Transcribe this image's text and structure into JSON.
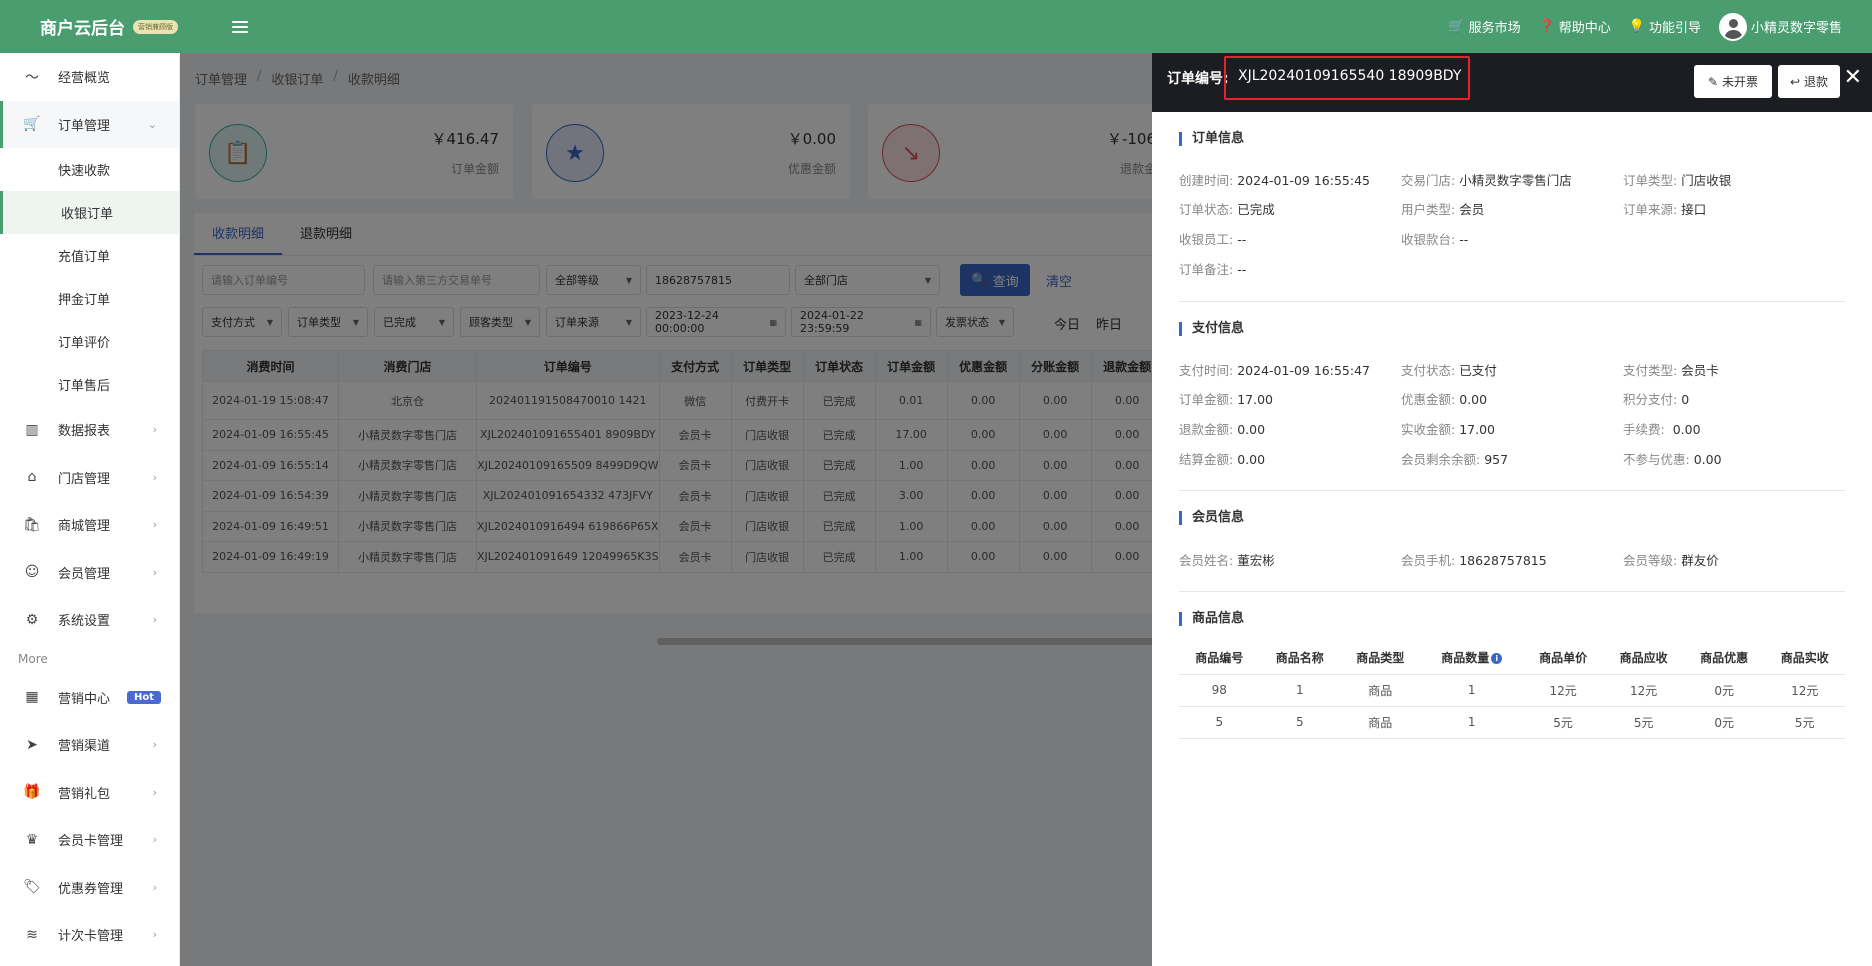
{
  "topbar": {
    "brand": "商户云后台",
    "brand_tag": "营销兼顾版",
    "links": [
      "服务市场",
      "帮助中心",
      "功能引导"
    ],
    "user": "小精灵数字零售"
  },
  "sidebar": {
    "items_top": [
      {
        "label": "经营概览",
        "icon": "chart-line-icon"
      },
      {
        "label": "订单管理",
        "icon": "cart-icon",
        "open": true
      }
    ],
    "sub_items": [
      "快速收款",
      "收银订单",
      "充值订单",
      "押金订单",
      "订单评价",
      "订单售后"
    ],
    "active_sub": "收银订单",
    "items_mid": [
      {
        "label": "数据报表",
        "icon": "bar-chart-icon"
      },
      {
        "label": "门店管理",
        "icon": "home-icon"
      },
      {
        "label": "商城管理",
        "icon": "shop-icon"
      },
      {
        "label": "会员管理",
        "icon": "smile-icon"
      },
      {
        "label": "系统设置",
        "icon": "gear-icon"
      }
    ],
    "more_label": "More",
    "items_bottom": [
      {
        "label": "营销中心",
        "icon": "grid-icon",
        "badge": "Hot"
      },
      {
        "label": "营销渠道",
        "icon": "send-icon"
      },
      {
        "label": "营销礼包",
        "icon": "gift-icon"
      },
      {
        "label": "会员卡管理",
        "icon": "crown-icon"
      },
      {
        "label": "优惠券管理",
        "icon": "tag-icon"
      },
      {
        "label": "计次卡管理",
        "icon": "layers-icon"
      }
    ]
  },
  "breadcrumb": [
    "订单管理",
    "收银订单",
    "收款明细"
  ],
  "stats": [
    {
      "value": "￥416.47",
      "label": "订单金额",
      "color": "#2fb3a0"
    },
    {
      "value": "￥0.00",
      "label": "优惠金额",
      "color": "#3a66c9"
    },
    {
      "value": "￥-106",
      "label": "退款金",
      "color": "#e14a5a"
    }
  ],
  "tabs": [
    "收款明细",
    "退款明细"
  ],
  "filters": {
    "order_no_placeholder": "请输入订单编号",
    "third_no_placeholder": "请输入第三方交易单号",
    "level": "全部等级",
    "phone": "18628757815",
    "store": "全部门店",
    "pay_method": "支付方式",
    "order_type": "订单类型",
    "status": "已完成",
    "customer_type": "顾客类型",
    "source": "订单来源",
    "start_time": "2023-12-24 00:00:00",
    "end_time": "2024-01-22 23:59:59",
    "invoice_status": "发票状态",
    "query_label": "查询",
    "clear_label": "清空",
    "today": "今日",
    "yesterday": "昨日"
  },
  "table": {
    "columns": [
      "消费时间",
      "消费门店",
      "订单编号",
      "支付方式",
      "订单类型",
      "订单状态",
      "订单金额",
      "优惠金额",
      "分账金额",
      "退款金额"
    ],
    "rows": [
      [
        "2024-01-19 15:08:47",
        "北京仓",
        "202401191508470010 1421",
        "微信",
        "付费开卡",
        "已完成",
        "0.01",
        "0.00",
        "0.00",
        "0.00"
      ],
      [
        "2024-01-09 16:55:45",
        "小精灵数字零售门店",
        "XJL202401091655401 8909BDY",
        "会员卡",
        "门店收银",
        "已完成",
        "17.00",
        "0.00",
        "0.00",
        "0.00"
      ],
      [
        "2024-01-09 16:55:14",
        "小精灵数字零售门店",
        "XJL20240109165509 8499D9QW",
        "会员卡",
        "门店收银",
        "已完成",
        "1.00",
        "0.00",
        "0.00",
        "0.00"
      ],
      [
        "2024-01-09 16:54:39",
        "小精灵数字零售门店",
        "XJL202401091654332 473JFVY",
        "会员卡",
        "门店收银",
        "已完成",
        "3.00",
        "0.00",
        "0.00",
        "0.00"
      ],
      [
        "2024-01-09 16:49:51",
        "小精灵数字零售门店",
        "XJL2024010916494 619866P65X",
        "会员卡",
        "门店收银",
        "已完成",
        "1.00",
        "0.00",
        "0.00",
        "0.00"
      ],
      [
        "2024-01-09 16:49:19",
        "小精灵数字零售门店",
        "XJL202401091649 12049965K3S",
        "会员卡",
        "门店收银",
        "已完成",
        "1.00",
        "0.00",
        "0.00",
        "0.00"
      ]
    ]
  },
  "drawer": {
    "title_label": "订单编号:",
    "order_no": "XJL20240109165540 18909BDY",
    "btn_invoice": "未开票",
    "btn_refund": "退款",
    "order_info": {
      "title": "订单信息",
      "fields": [
        [
          "创建时间:",
          "2024-01-09 16:55:45"
        ],
        [
          "交易门店:",
          "小精灵数字零售门店"
        ],
        [
          "订单类型:",
          "门店收银"
        ],
        [
          "订单状态:",
          "已完成"
        ],
        [
          "用户类型:",
          "会员"
        ],
        [
          "订单来源:",
          "接口"
        ],
        [
          "收银员工:",
          "--"
        ],
        [
          "收银款台:",
          "--"
        ],
        [
          "订单备注:",
          "--"
        ]
      ]
    },
    "pay_info": {
      "title": "支付信息",
      "fields": [
        [
          "支付时间:",
          "2024-01-09 16:55:47"
        ],
        [
          "支付状态:",
          "已支付"
        ],
        [
          "支付类型:",
          "会员卡"
        ],
        [
          "订单金额:",
          "17.00"
        ],
        [
          "优惠金额:",
          "0.00"
        ],
        [
          "积分支付:",
          "0"
        ],
        [
          "退款金额:",
          "0.00"
        ],
        [
          "实收金额:",
          "17.00"
        ],
        [
          "手续费:",
          " 0.00"
        ],
        [
          "结算金额:",
          "0.00"
        ],
        [
          "会员剩余余额:",
          "957"
        ],
        [
          "不参与优惠:",
          "0.00"
        ]
      ]
    },
    "member_info": {
      "title": "会员信息",
      "fields": [
        [
          "会员姓名:",
          "董宏彬"
        ],
        [
          "会员手机:",
          "18628757815"
        ],
        [
          "会员等级:",
          "群友价"
        ]
      ]
    },
    "goods_info": {
      "title": "商品信息",
      "columns": [
        "商品编号",
        "商品名称",
        "商品类型",
        "商品数量",
        "商品单价",
        "商品应收",
        "商品优惠",
        "商品实收"
      ],
      "rows": [
        [
          "98",
          "1",
          "商品",
          "1",
          "12元",
          "12元",
          "0元",
          "12元"
        ],
        [
          "5",
          "5",
          "商品",
          "1",
          "5元",
          "5元",
          "0元",
          "5元"
        ]
      ]
    }
  }
}
